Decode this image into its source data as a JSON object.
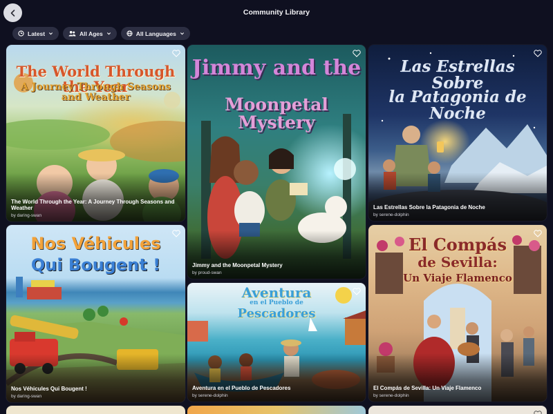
{
  "header": {
    "title": "Community Library",
    "back_icon": "chevron-left-icon"
  },
  "filters": {
    "sort": {
      "label": "Latest",
      "icon": "clock-icon"
    },
    "age": {
      "label": "All Ages",
      "icon": "users-icon"
    },
    "language": {
      "label": "All Languages",
      "icon": "globe-icon"
    }
  },
  "books": [
    {
      "title": "The World Through the Year: A Journey Through Seasons and Weather",
      "author": "by daring-swan",
      "cover_line1": "The World Through the Year",
      "cover_line2": "A Journey Through Seasons and Weather"
    },
    {
      "title": "Jimmy and the Moonpetal Mystery",
      "author": "by proud-swan",
      "cover_line1": "Jimmy and the",
      "cover_line2": "Moonpetal Mystery"
    },
    {
      "title": "Las Estrellas Sobre la Patagonia de Noche",
      "author": "by serene-dolphin",
      "cover_line1": "Las Estrellas Sobre",
      "cover_line2": "la Patagonia de Noche"
    },
    {
      "title": "Nos Véhicules Qui Bougent !",
      "author": "by daring-swan",
      "cover_line1": "Nos Véhicules",
      "cover_line2": "Qui Bougent !"
    },
    {
      "title": "Aventura en el Pueblo de Pescadores",
      "author": "by serene-dolphin",
      "cover_line1": "Aventura",
      "cover_line_mid": "en el Pueblo de",
      "cover_line2": "Pescadores"
    },
    {
      "title": "El Compás de Sevilla: Un Viaje Flamenco",
      "author": "by serene-dolphin",
      "cover_line1": "El Compás",
      "cover_line_mid": "de Sevilla:",
      "cover_line2": "Un Viaje Flamenco"
    }
  ],
  "colors": {
    "background": "#0f1020",
    "chip": "#2c2e42",
    "back_button": "#dcdde3"
  }
}
